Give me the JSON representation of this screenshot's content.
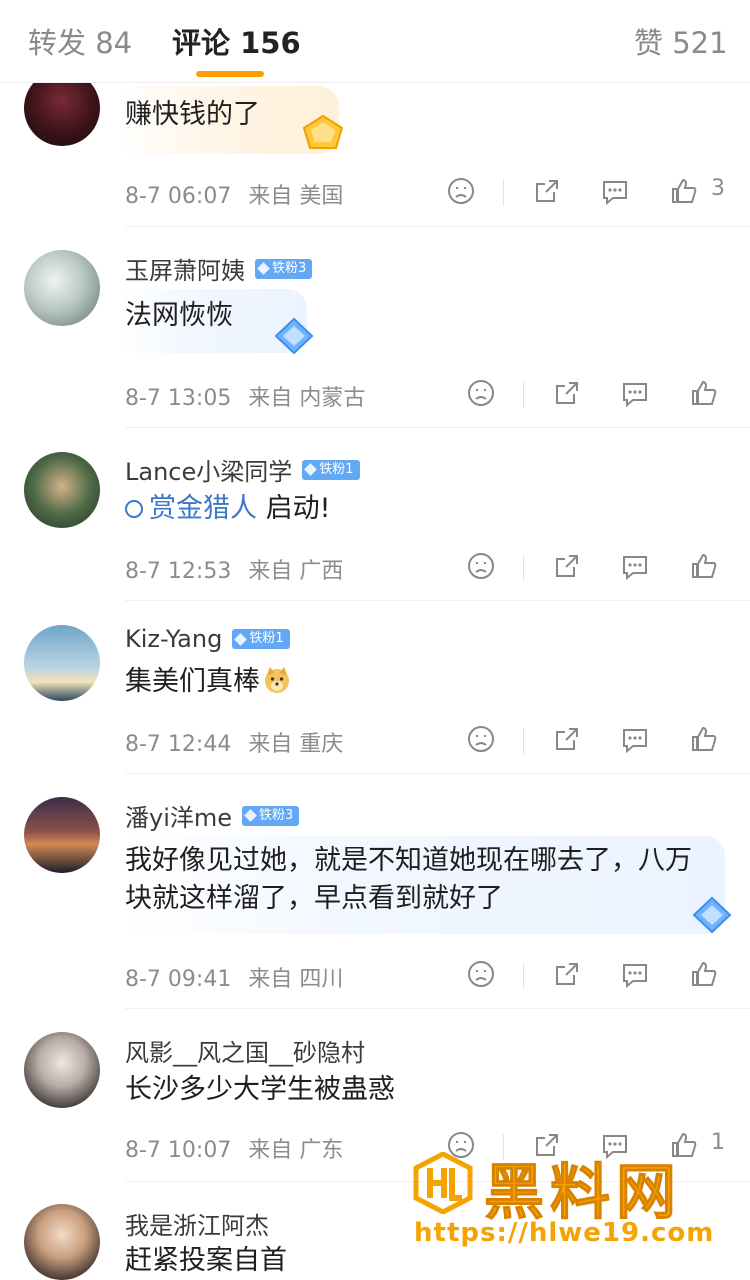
{
  "tabs": {
    "repost": "转发 84",
    "comments": "评论 156",
    "likes": "赞 521"
  },
  "comments": [
    {
      "username": "",
      "badge": "",
      "text": "赚快钱的了",
      "time": "8-7 06:07",
      "location": "来自 美国",
      "likes": "3"
    },
    {
      "username": "玉屏萧阿姨",
      "badge": "铁粉3",
      "text": "法网恢恢",
      "time": "8-7 13:05",
      "location": "来自 内蒙古",
      "likes": ""
    },
    {
      "username": "Lance小梁同学",
      "badge": "铁粉1",
      "topic": "赏金猎人",
      "text": " 启动!",
      "time": "8-7 12:53",
      "location": "来自 广西",
      "likes": ""
    },
    {
      "username": "Kiz-Yang",
      "badge": "铁粉1",
      "text": "集美们真棒",
      "emoji": "doge-emoji",
      "time": "8-7 12:44",
      "location": "来自 重庆",
      "likes": ""
    },
    {
      "username": "潘yi洋me",
      "badge": "铁粉3",
      "text": "我好像见过她，就是不知道她现在哪去了，八万块就这样溜了，早点看到就好了",
      "time": "8-7 09:41",
      "location": "来自 四川",
      "likes": ""
    },
    {
      "username": "风影__风之国__砂隐村",
      "badge": "",
      "text": "长沙多少大学生被蛊惑",
      "time": "8-7 10:07",
      "location": "来自 广东",
      "likes": "1"
    },
    {
      "username": "我是浙江阿杰",
      "badge": "",
      "text": "赶紧投案自首",
      "time": "",
      "location": "",
      "likes": ""
    }
  ],
  "watermark": {
    "title": "黑料网",
    "url": "https://hlwe19.com"
  },
  "colors": {
    "accent": "#ff9c00",
    "fan_badge": "#63a8f5",
    "topic": "#3a78c9",
    "watermark": "#f5a300"
  },
  "icons": [
    "dislike-icon",
    "share-icon",
    "reply-icon",
    "like-icon",
    "topic-search-icon",
    "fan-badge-diamond-icon"
  ]
}
